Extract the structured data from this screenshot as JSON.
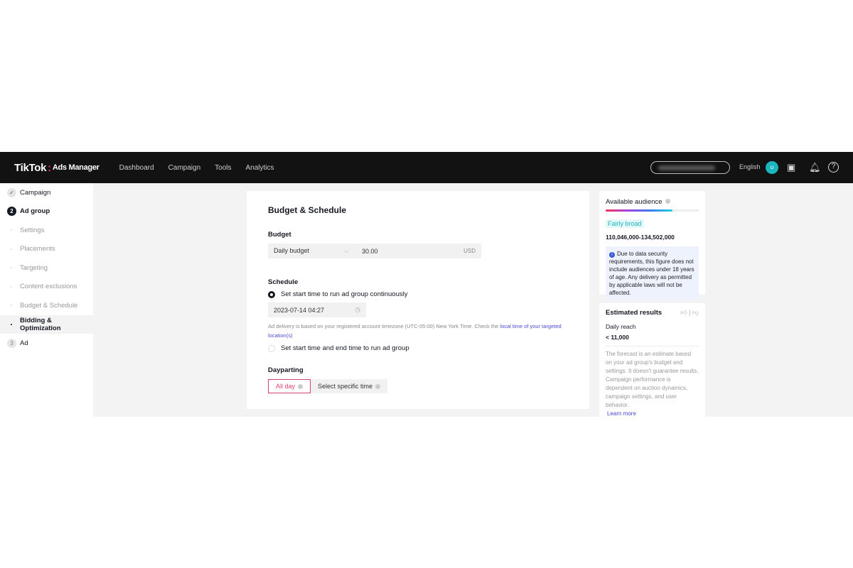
{
  "header": {
    "logo_main": "TikTok",
    "logo_sub": "Ads Manager",
    "nav": [
      "Dashboard",
      "Campaign",
      "Tools",
      "Analytics"
    ],
    "language": "English",
    "avatar_letter": "u"
  },
  "sidebar": {
    "items": [
      {
        "label": "Campaign",
        "badge": "✓",
        "level": "main"
      },
      {
        "label": "Ad group",
        "badge": "2",
        "level": "main"
      },
      {
        "label": "Settings",
        "level": "sub"
      },
      {
        "label": "Placements",
        "level": "sub"
      },
      {
        "label": "Targeting",
        "level": "sub"
      },
      {
        "label": "Content exclusions",
        "level": "sub"
      },
      {
        "label": "Budget & Schedule",
        "level": "sub"
      },
      {
        "label": "Bidding & Optimization",
        "level": "sub",
        "active": true
      },
      {
        "label": "Ad",
        "badge": "3",
        "level": "main"
      }
    ]
  },
  "main": {
    "title": "Budget & Schedule",
    "budget_label": "Budget",
    "budget_type": "Daily budget",
    "budget_value": "30.00",
    "currency": "USD",
    "schedule_label": "Schedule",
    "option1": "Set start time to run ad group continuously",
    "start_time": "2023-07-14 04:27",
    "note_text": "Ad delivery is based on your registered account timezone (UTC-05:00) New York Time. Check the ",
    "note_link": "local time of your targeted location(s)",
    "option2": "Set start time and end time to run ad group",
    "dayparting_label": "Dayparting",
    "daypart_all": "All day",
    "daypart_specific": "Select specific time"
  },
  "audience": {
    "title": "Available audience",
    "level": "Fairly broad",
    "level_fraction": 0.72,
    "range": "110,046,000-134,502,000",
    "info": "Due to data security requirements, this figure does not include audiences under 18 years of age. Any delivery as permitted by applicable laws will not be affected."
  },
  "estimate": {
    "title": "Estimated results",
    "metric_label": "Daily reach",
    "metric_value": "< 11,000",
    "disclaimer": "The forecast is an estimate based on your ad group's budget and settings. It doesn't guarantee results. Campaign performance is dependent on auction dynamics, campaign settings, and user behavior.",
    "learn_more": "Learn more"
  },
  "colors": {
    "accent": "#fe2c55",
    "teal": "#1bb5bd",
    "link": "#4a4ad0"
  }
}
